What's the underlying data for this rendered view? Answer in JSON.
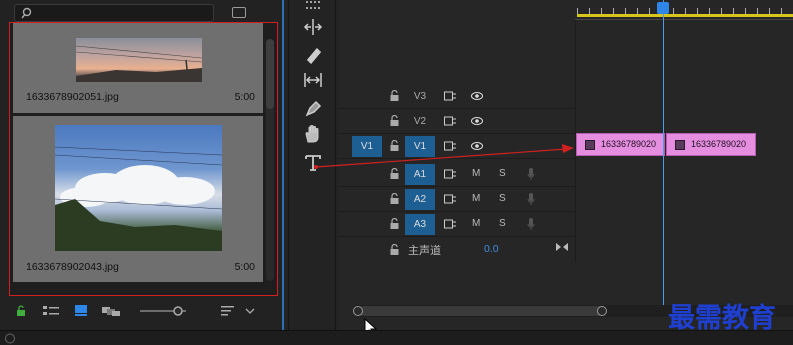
{
  "project": {
    "items": [
      {
        "name": "1633678902051.jpg",
        "duration": "5:00"
      },
      {
        "name": "1633678902043.jpg",
        "duration": "5:00"
      }
    ]
  },
  "timeline": {
    "tracks": [
      {
        "target": "",
        "name": "V3",
        "kind": "video"
      },
      {
        "target": "",
        "name": "V2",
        "kind": "video"
      },
      {
        "target": "V1",
        "name": "V1",
        "kind": "video"
      },
      {
        "target": "",
        "name": "A1",
        "kind": "audio",
        "m": "M",
        "s": "S"
      },
      {
        "target": "",
        "name": "A2",
        "kind": "audio",
        "m": "M",
        "s": "S"
      },
      {
        "target": "",
        "name": "A3",
        "kind": "audio",
        "m": "M",
        "s": "S"
      }
    ],
    "master": {
      "label": "主声道",
      "value": "0.0"
    },
    "clips": [
      {
        "label": "16336789020"
      },
      {
        "label": "16336789020"
      }
    ]
  },
  "watermark": "最需教育",
  "colors": {
    "accent": "#1e5f93",
    "clip": "#e58ee0",
    "playhead": "#4d9bf0",
    "highlight_border": "#d02020",
    "annotation_arrow": "#d02020"
  }
}
